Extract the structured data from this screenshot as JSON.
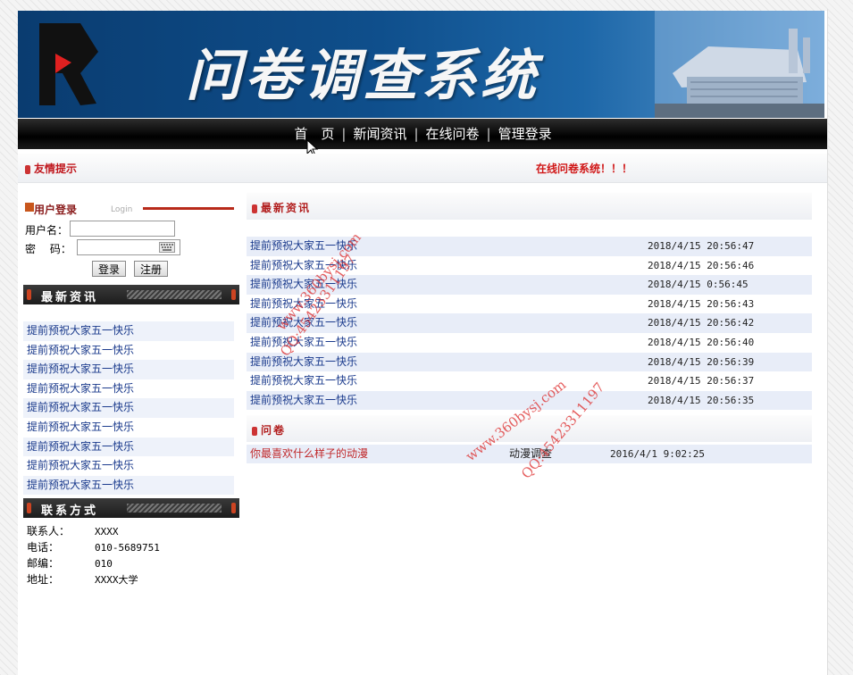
{
  "banner": {
    "title": "问卷调查系统",
    "colors": {
      "bg": "#0f4f8c",
      "logo_red": "#e02020"
    }
  },
  "nav": {
    "items": [
      {
        "label": "首　页"
      },
      {
        "label": "新闻资讯"
      },
      {
        "label": "在线问卷"
      },
      {
        "label": "管理登录"
      }
    ],
    "separator": "|"
  },
  "notice": {
    "title": "友情提示",
    "text": "在线问卷系统！！！"
  },
  "login": {
    "title": "用户登录",
    "subtitle": "Login",
    "username_label": "用户名：",
    "password_label": "密　 码：",
    "username_value": "",
    "password_value": "",
    "login_button": "登录",
    "register_button": "注册"
  },
  "side_news": {
    "title": "最新资讯",
    "items": [
      "提前预祝大家五一快乐",
      "提前预祝大家五一快乐",
      "提前预祝大家五一快乐",
      "提前预祝大家五一快乐",
      "提前预祝大家五一快乐",
      "提前预祝大家五一快乐",
      "提前预祝大家五一快乐",
      "提前预祝大家五一快乐",
      "提前预祝大家五一快乐"
    ]
  },
  "contact": {
    "title": "联系方式",
    "rows": [
      {
        "key": "联系人：",
        "value": "XXXX"
      },
      {
        "key": "电话：",
        "value": "010-5689751"
      },
      {
        "key": "邮编：",
        "value": "010"
      },
      {
        "key": "地址：",
        "value": "XXXX大学"
      }
    ]
  },
  "main_news": {
    "title": "最新资讯",
    "rows": [
      {
        "title": "提前预祝大家五一快乐",
        "date": "2018/4/15 20:56:47"
      },
      {
        "title": "提前预祝大家五一快乐",
        "date": "2018/4/15 20:56:46"
      },
      {
        "title": "提前预祝大家五一快乐",
        "date": "2018/4/15 0:56:45"
      },
      {
        "title": "提前预祝大家五一快乐",
        "date": "2018/4/15 20:56:43"
      },
      {
        "title": "提前预祝大家五一快乐",
        "date": "2018/4/15 20:56:42"
      },
      {
        "title": "提前预祝大家五一快乐",
        "date": "2018/4/15 20:56:40"
      },
      {
        "title": "提前预祝大家五一快乐",
        "date": "2018/4/15 20:56:39"
      },
      {
        "title": "提前预祝大家五一快乐",
        "date": "2018/4/15 20:56:37"
      },
      {
        "title": "提前预祝大家五一快乐",
        "date": "2018/4/15 20:56:35"
      }
    ]
  },
  "questionnaire": {
    "title": "问卷",
    "rows": [
      {
        "title": "你最喜欢什么样子的动漫",
        "category": "动漫调查",
        "date": "2016/4/1 9:02:25"
      }
    ]
  },
  "watermarks": [
    "www.360bysj.com",
    "QQ:45423311197",
    "www.360bysj.com",
    "QQ:45423311197"
  ]
}
